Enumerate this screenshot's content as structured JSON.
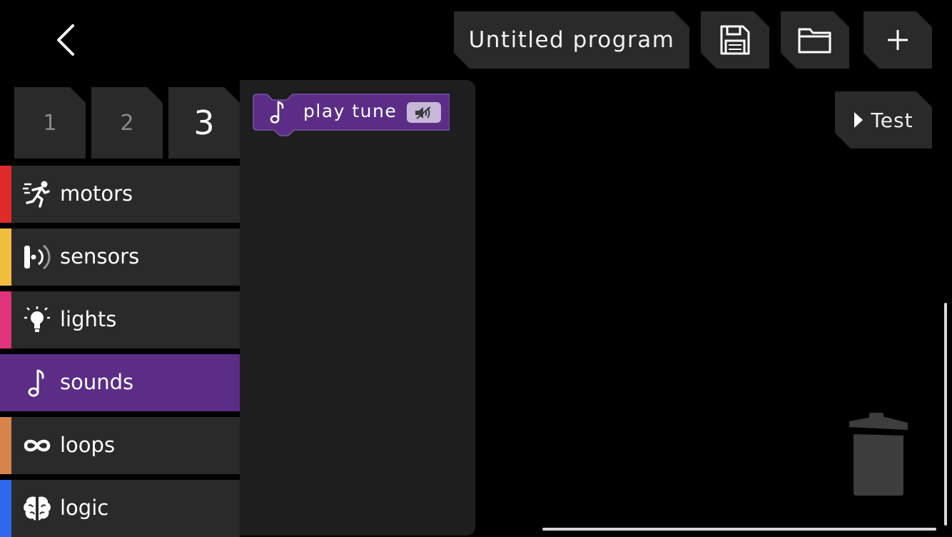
{
  "header": {
    "program_name": "Untitled program",
    "back_icon": "chevron-left-icon",
    "save_icon": "floppy-disk-icon",
    "open_icon": "folder-icon",
    "add_label": "+"
  },
  "test_button": {
    "label": "Test",
    "icon": "play-triangle-icon"
  },
  "page_tabs": [
    {
      "label": "1",
      "active": false
    },
    {
      "label": "2",
      "active": false
    },
    {
      "label": "3",
      "active": true
    }
  ],
  "categories": [
    {
      "label": "motors",
      "icon": "running-person-icon",
      "color": "#e02a2a",
      "selected": false
    },
    {
      "label": "sensors",
      "icon": "sensor-icon",
      "color": "#f0be3c",
      "selected": false
    },
    {
      "label": "lights",
      "icon": "lightbulb-icon",
      "color": "#e0337a",
      "selected": false
    },
    {
      "label": "sounds",
      "icon": "music-note-icon",
      "color": "#5b2d87",
      "selected": true
    },
    {
      "label": "loops",
      "icon": "infinity-icon",
      "color": "#d8834a",
      "selected": false
    },
    {
      "label": "logic",
      "icon": "brain-icon",
      "color": "#2e67f0",
      "selected": false
    }
  ],
  "palette": {
    "blocks": [
      {
        "label": "play tune",
        "icon": "music-note-icon",
        "badge_icon": "speaker-icon",
        "color": "#5b2d87"
      }
    ]
  },
  "trash": {
    "icon": "trash-can-icon"
  }
}
